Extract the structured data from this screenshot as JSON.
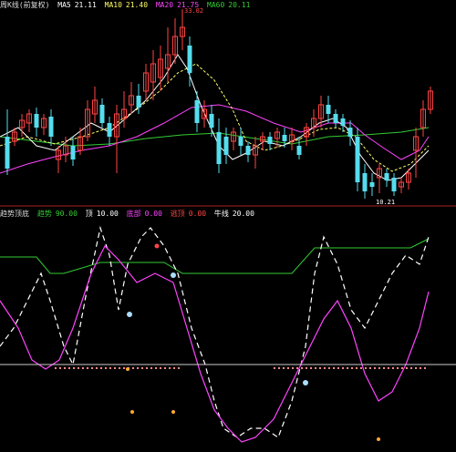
{
  "colors": {
    "up": "#ff4444",
    "down": "#55ddee",
    "ma_white": "#ffffff",
    "ma_yellow": "#ffff66",
    "ma_magenta": "#ff44ff",
    "ma_green": "#33cc33",
    "bg": "#000000",
    "separator": "#aa2222"
  },
  "top_panel": {
    "title": "周K线(前复权)",
    "indicators": [
      {
        "label": "MA5",
        "value": "21.11",
        "color": "#ffffff"
      },
      {
        "label": "MA10",
        "value": "21.40",
        "color": "#ffff66"
      },
      {
        "label": "MA20",
        "value": "21.75",
        "color": "#ff44ff"
      },
      {
        "label": "MA60",
        "value": "20.11",
        "color": "#33cc33"
      }
    ],
    "price_markers": [
      {
        "text": "33.02",
        "color": "#ff4444"
      },
      {
        "text": "10.21",
        "color": "#ffffff"
      }
    ]
  },
  "bottom_panel": {
    "title": "趋势顶底",
    "indicators": [
      {
        "label": "趋势",
        "value": "90.00",
        "color": "#33cc33"
      },
      {
        "label": "顶",
        "value": "10.00",
        "color": "#ffffff"
      },
      {
        "label": "底部",
        "value": "0.00",
        "color": "#ff44ff"
      },
      {
        "label": "逃顶",
        "value": "0.00",
        "color": "#ff4444"
      },
      {
        "label": "牛线",
        "value": "20.00",
        "color": "#ffffff"
      }
    ]
  }
}
